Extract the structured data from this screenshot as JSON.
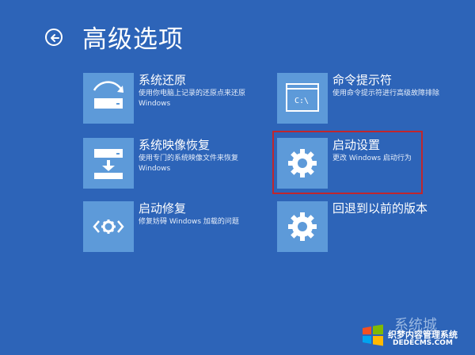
{
  "header": {
    "title": "高级选项"
  },
  "options": [
    {
      "title": "系统还原",
      "description": "使用你电脑上记录的还原点来还原 Windows",
      "icon": "system-restore-icon"
    },
    {
      "title": "系统映像恢复",
      "description": "使用专门的系统映像文件来恢复 Windows",
      "icon": "system-image-icon"
    },
    {
      "title": "启动修复",
      "description": "修复妨碍 Windows 加载的问题",
      "icon": "startup-repair-icon"
    },
    {
      "title": "命令提示符",
      "description": "使用命令提示符进行高级故障排除",
      "icon": "command-prompt-icon",
      "tile_text": "C:\\"
    },
    {
      "title": "启动设置",
      "description": "更改 Windows 启动行为",
      "icon": "gear-icon"
    },
    {
      "title": "回退到以前的版本",
      "description": "",
      "icon": "gear-icon"
    }
  ],
  "highlight_color": "#c0262d",
  "watermark": {
    "brand": "系统城",
    "site_cn": "织梦内容管理系统",
    "url": "DEDECMS.COM"
  }
}
